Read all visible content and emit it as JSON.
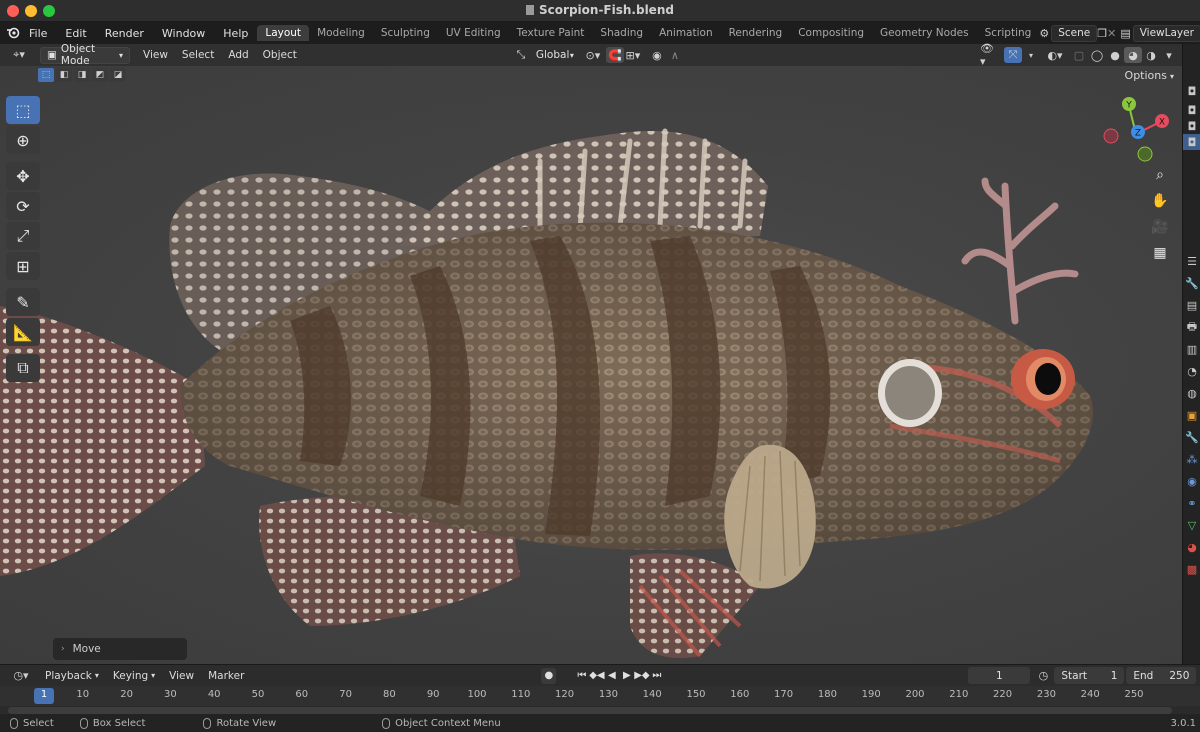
{
  "window": {
    "title": "Scorpion-Fish.blend"
  },
  "traffic_lights": {
    "close_color": "#ff5f57",
    "minimize_color": "#febc2e",
    "zoom_color": "#28c840"
  },
  "menu": {
    "items": [
      "File",
      "Edit",
      "Render",
      "Window",
      "Help"
    ]
  },
  "workspaces": {
    "active": "Layout",
    "tabs": [
      "Layout",
      "Modeling",
      "Sculpting",
      "UV Editing",
      "Texture Paint",
      "Shading",
      "Animation",
      "Rendering",
      "Compositing",
      "Geometry Nodes",
      "Scripting"
    ]
  },
  "scene": {
    "name": "Scene"
  },
  "view_layer": {
    "name": "ViewLayer"
  },
  "viewport_header": {
    "mode": "Object Mode",
    "menus": [
      "View",
      "Select",
      "Add",
      "Object"
    ],
    "transform_orientation": "Global",
    "options_label": "Options"
  },
  "gizmo": {
    "x_color": "#e84a5f",
    "y_color": "#8cc63f",
    "z_color": "#3d8ee6",
    "x_label": "X",
    "y_label": "Y",
    "z_label": "Z"
  },
  "operator_panel": {
    "label": "Move"
  },
  "timeline": {
    "menus": [
      "Playback",
      "Keying",
      "View",
      "Marker"
    ],
    "current_frame": "1",
    "start_label": "Start",
    "start_value": "1",
    "end_label": "End",
    "end_value": "250",
    "ruler_ticks": [
      "1",
      "10",
      "20",
      "30",
      "40",
      "50",
      "60",
      "70",
      "80",
      "90",
      "100",
      "110",
      "120",
      "130",
      "140",
      "150",
      "160",
      "170",
      "180",
      "190",
      "200",
      "210",
      "220",
      "230",
      "240",
      "250"
    ]
  },
  "statusbar": {
    "select": "Select",
    "box_select": "Box Select",
    "rotate_view": "Rotate View",
    "context_menu": "Object Context Menu",
    "version": "3.0.1"
  },
  "colors": {
    "accent": "#4772b3",
    "viewport_bg": "#444444",
    "header_bg": "#303030"
  }
}
